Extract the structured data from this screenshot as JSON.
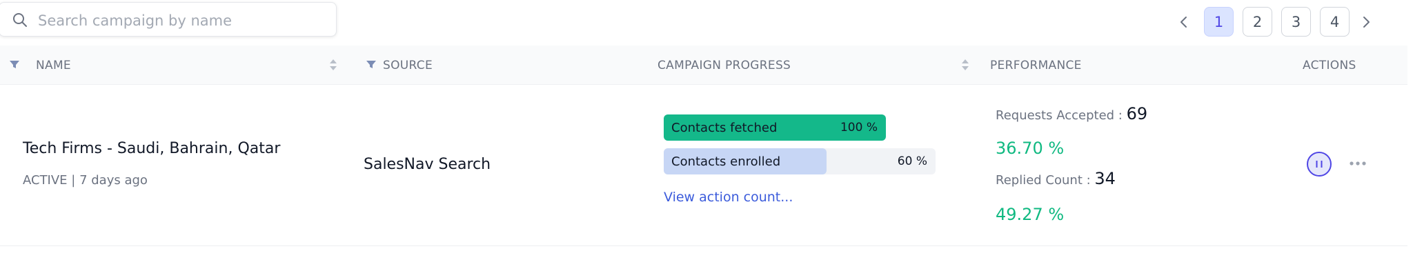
{
  "search": {
    "placeholder": "Search campaign by name",
    "value": ""
  },
  "pagination": {
    "pages": [
      "1",
      "2",
      "3",
      "4"
    ],
    "active": "1"
  },
  "table": {
    "headers": {
      "name": "NAME",
      "source": "SOURCE",
      "campaign_progress": "CAMPAIGN PROGRESS",
      "performance": "PERFORMANCE",
      "actions": "ACTIONS"
    },
    "rows": [
      {
        "name": "Tech Firms - Saudi, Bahrain, Qatar",
        "status_line": "ACTIVE | 7 days ago",
        "source": "SalesNav Search",
        "progress": [
          {
            "label": "Contacts fetched",
            "percent_text": "100 %",
            "value": 100,
            "color": "#14b88a"
          },
          {
            "label": "Contacts enrolled",
            "percent_text": "60 %",
            "value": 60,
            "color": "#c7d6f5"
          }
        ],
        "view_link": "View action count...",
        "performance": {
          "accepted_label": "Requests Accepted :",
          "accepted_value": "69",
          "accepted_rate": "36.70 %",
          "replied_label": "Replied Count :",
          "replied_value": "34",
          "replied_rate": "49.27 %"
        }
      }
    ]
  },
  "icons": {
    "search": "search-icon",
    "prev": "chevron-left-icon",
    "next": "chevron-right-icon",
    "filter": "filter-icon",
    "sort": "sort-icon",
    "pause": "pause-icon",
    "more": "more-horizontal-icon"
  },
  "colors": {
    "accent": "#4f46e5",
    "success": "#10b981",
    "link": "#3b5bdb"
  }
}
